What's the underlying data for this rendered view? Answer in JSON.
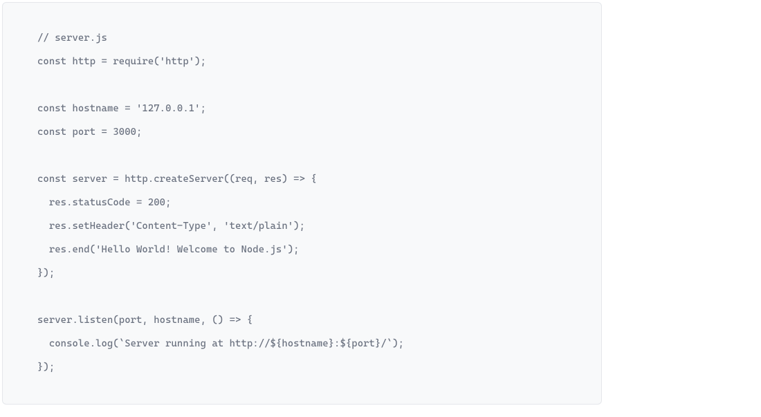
{
  "code": {
    "lines": [
      "// server.js",
      "const http = require('http');",
      "",
      "const hostname = '127.0.0.1';",
      "const port = 3000;",
      "",
      "const server = http.createServer((req, res) => {",
      "  res.statusCode = 200;",
      "  res.setHeader('Content-Type', 'text/plain');",
      "  res.end('Hello World! Welcome to Node.js');",
      "});",
      "",
      "server.listen(port, hostname, () => {",
      "  console.log(`Server running at http://${hostname}:${port}/`);",
      "});"
    ]
  }
}
